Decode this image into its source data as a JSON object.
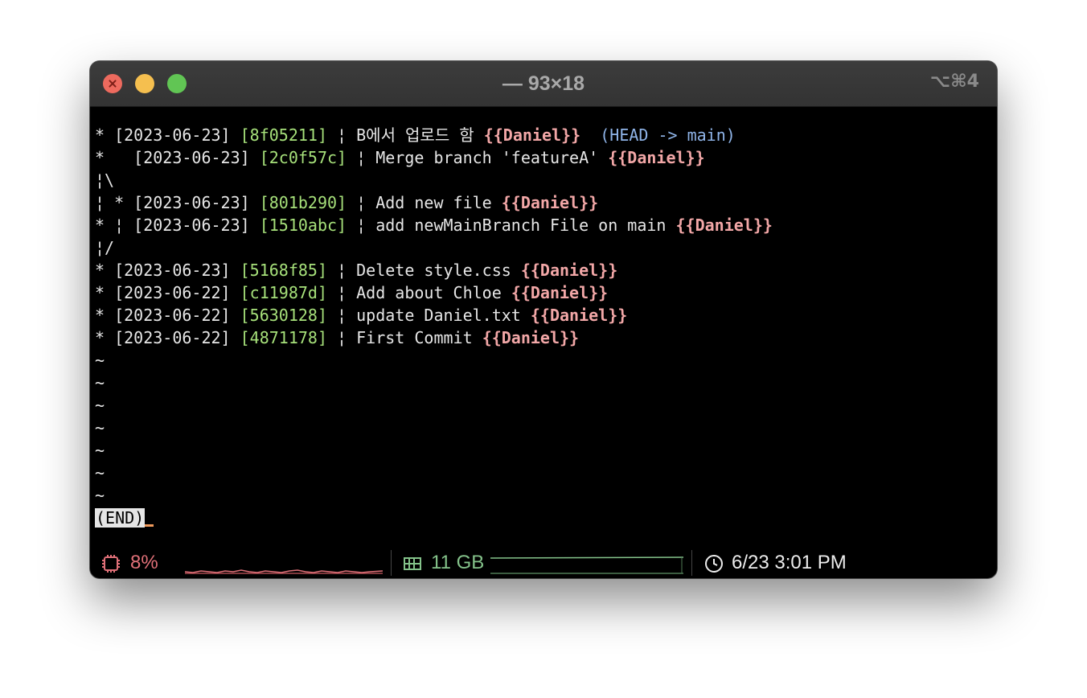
{
  "window": {
    "title": "— 93×18",
    "shortcut": "⌥⌘4"
  },
  "log": [
    {
      "prefix": "* ",
      "date": "[2023-06-23]",
      "hash": "[8f05211]",
      "message": "B에서 업로드 함",
      "author": "{{Daniel}}",
      "ref": "(HEAD -> main)"
    },
    {
      "prefix": "*   ",
      "date": "[2023-06-23]",
      "hash": "[2c0f57c]",
      "message": "Merge branch 'featureA'",
      "author": "{{Daniel}}"
    },
    {
      "graph": "¦\\"
    },
    {
      "prefix": "¦ * ",
      "date": "[2023-06-23]",
      "hash": "[801b290]",
      "message": "Add new file",
      "author": "{{Daniel}}"
    },
    {
      "prefix": "* ¦ ",
      "date": "[2023-06-23]",
      "hash": "[1510abc]",
      "message": "add newMainBranch File on main",
      "author": "{{Daniel}}"
    },
    {
      "graph": "¦/"
    },
    {
      "prefix": "* ",
      "date": "[2023-06-23]",
      "hash": "[5168f85]",
      "message": "Delete style.css",
      "author": "{{Daniel}}"
    },
    {
      "prefix": "* ",
      "date": "[2023-06-22]",
      "hash": "[c11987d]",
      "message": "Add about Chloe",
      "author": "{{Daniel}}"
    },
    {
      "prefix": "* ",
      "date": "[2023-06-22]",
      "hash": "[5630128]",
      "message": "update Daniel.txt",
      "author": "{{Daniel}}"
    },
    {
      "prefix": "* ",
      "date": "[2023-06-22]",
      "hash": "[4871178]",
      "message": "First Commit",
      "author": "{{Daniel}}"
    }
  ],
  "filler": [
    "~",
    "~",
    "~",
    "~",
    "~",
    "~",
    "~"
  ],
  "pager_status": "(END)",
  "status": {
    "cpu": "8%",
    "memory": "11 GB",
    "clock": "6/23 3:01 PM"
  },
  "colors": {
    "hash": "#a6e07a",
    "author": "#f2a7a7",
    "ref": "#8fb4e8",
    "cpu": "#e07078",
    "memory": "#84c28a",
    "cursor": "#f09a5c"
  },
  "icons": {
    "cpu": "cpu-chip-icon",
    "memory": "memory-icon",
    "clock": "clock-icon"
  }
}
